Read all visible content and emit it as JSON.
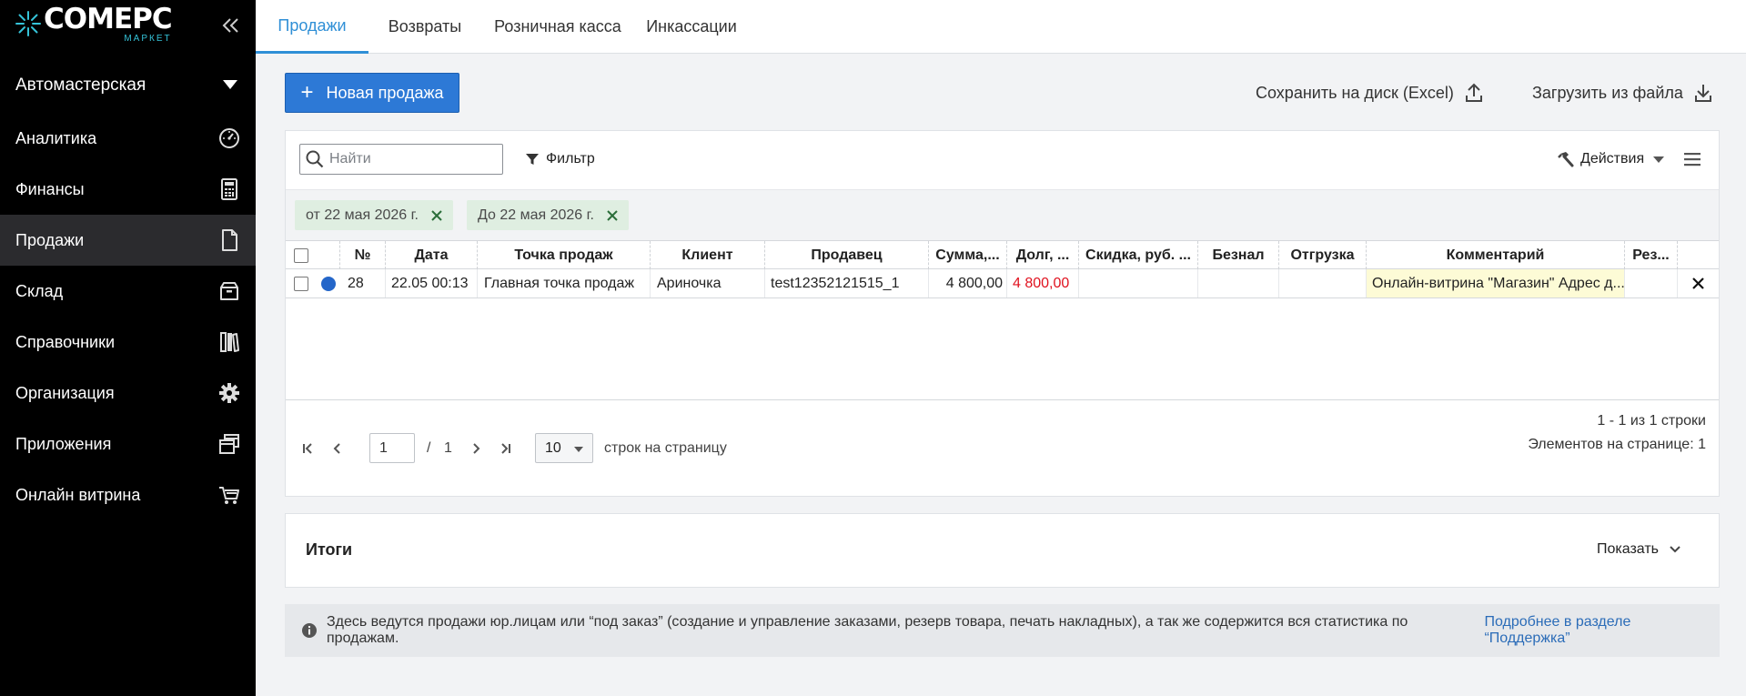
{
  "brand": {
    "name": "COMEPC",
    "subtitle": "МАРКЕТ",
    "accent": "#35c3d8",
    "logo_icon": "star-burst-icon"
  },
  "sidebar": {
    "organization": "Автомастерская",
    "items": [
      {
        "label": "Аналитика",
        "icon": "gauge-icon",
        "active": false
      },
      {
        "label": "Финансы",
        "icon": "calculator-icon",
        "active": false
      },
      {
        "label": "Продажи",
        "icon": "document-icon",
        "active": true
      },
      {
        "label": "Склад",
        "icon": "box-icon",
        "active": false
      },
      {
        "label": "Справочники",
        "icon": "books-icon",
        "active": false
      },
      {
        "label": "Организация",
        "icon": "gear-icon",
        "active": false
      },
      {
        "label": "Приложения",
        "icon": "windows-icon",
        "active": false
      },
      {
        "label": "Онлайн витрина",
        "icon": "cart-icon",
        "active": false
      }
    ]
  },
  "tabs": [
    {
      "label": "Продажи",
      "active": true
    },
    {
      "label": "Возвраты",
      "active": false
    },
    {
      "label": "Розничная касса",
      "active": false
    },
    {
      "label": "Инкассации",
      "active": false
    }
  ],
  "toolbar": {
    "new_sale": "Новая продажа",
    "save_excel": "Сохранить на диск (Excel)",
    "load_file": "Загрузить из файла"
  },
  "search": {
    "placeholder": "Найти",
    "filter_label": "Фильтр",
    "actions_label": "Действия"
  },
  "filters": [
    {
      "label": "от 22 мая 2026 г."
    },
    {
      "label": "До 22 мая 2026 г."
    }
  ],
  "table": {
    "columns": [
      "№",
      "Дата",
      "Точка продаж",
      "Клиент",
      "Продавец",
      "Сумма,...",
      "Долг, ...",
      "Скидка, руб. ...",
      "Безнал",
      "Отгрузка",
      "Комментарий",
      "Рез..."
    ],
    "rows": [
      {
        "number": "28",
        "date": "22.05 00:13",
        "point": "Главная точка продаж",
        "client": "Ариночка",
        "seller": "test12352121515_1",
        "sum": "4 800,00",
        "debt": "4 800,00",
        "discount": "",
        "cashless": "",
        "shipment": "",
        "comment": "Онлайн-витрина \"Магазин\" Адрес д...",
        "reserve": ""
      }
    ]
  },
  "pagination": {
    "current_page": "1",
    "separator": "/",
    "total_pages": "1",
    "page_size": "10",
    "per_page_label": "строк на страницу",
    "range_text": "1 - 1 из 1 строки",
    "items_text": "Элементов на странице: 1"
  },
  "totals": {
    "title": "Итоги",
    "show_label": "Показать"
  },
  "info": {
    "text": "Здесь ведутся продажи юр.лицам или “под заказ” (создание и управление заказами, резерв товара, печать накладных), а так же содержится вся статистика по продажам.",
    "link": "Подробнее в разделе “Поддержка”"
  },
  "colors": {
    "primary": "#2d79d6",
    "tab_active": "#2f8fd6",
    "debt_red": "#e0121f",
    "chip_bg": "#dfeee1",
    "comment_bg": "#fdfbd6",
    "status_dot": "#2466c9"
  }
}
